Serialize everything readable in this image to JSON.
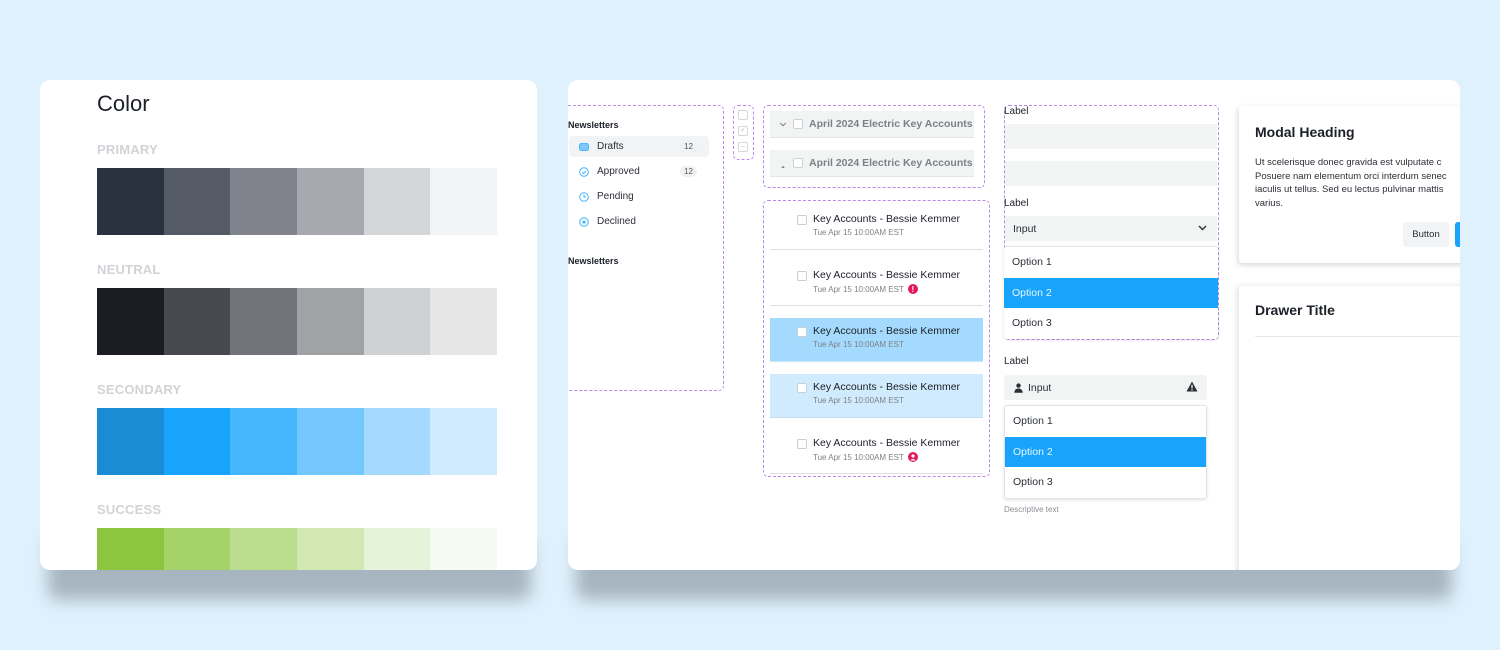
{
  "color_card": {
    "title": "Color",
    "palettes": [
      {
        "label": "PRIMARY",
        "swatches": [
          "#2a3240",
          "#545a66",
          "#80838b",
          "#a6a9b0",
          "#d4d6d9",
          "#f2f3f4"
        ]
      },
      {
        "label": "NEUTRAL",
        "swatches": [
          "#1a1d24",
          "#464950",
          "#727479",
          "#a1a2a6",
          "#d0d1d3",
          "#e6e6e6"
        ]
      },
      {
        "label": "SECONDARY",
        "swatches": [
          "#1a8cd6",
          "#18a4fb",
          "#46b6fc",
          "#73c7fd",
          "#a4dafd",
          "#d0ebfd"
        ]
      },
      {
        "label": "SUCCESS",
        "swatches": [
          "#8cc63f",
          "#a6d26a",
          "#bbdd8e",
          "#d2e8b3",
          "#e5f3d8",
          "#f6faf1"
        ]
      }
    ]
  },
  "nav": {
    "heading_1": "Newsletters",
    "heading_2": "Newsletters",
    "items": [
      {
        "label": "Drafts",
        "icon": "inbox-icon",
        "count": "12",
        "active": true
      },
      {
        "label": "Approved",
        "icon": "check-circle-icon",
        "count": "12",
        "active": false
      },
      {
        "label": "Pending",
        "icon": "clock-icon",
        "count": "",
        "active": false
      },
      {
        "label": "Declined",
        "icon": "x-circle-icon",
        "count": "",
        "active": false
      }
    ]
  },
  "checkbox_states": [
    "unchecked",
    "checked",
    "indeterminate"
  ],
  "accordion": {
    "rows": [
      {
        "label": "April 2024 Electric Key Accounts",
        "state": "collapsed",
        "chevron": "chevron-down-icon"
      },
      {
        "label": "April 2024 Electric Key Accounts",
        "state": "expanded",
        "chevron": "chevron-up-icon"
      }
    ]
  },
  "list": {
    "items": [
      {
        "title": "Key Accounts - Bessie Kemmer",
        "subtitle": "Tue Apr 15 10:00AM EST",
        "status": "",
        "state": "default"
      },
      {
        "title": "Key Accounts - Bessie Kemmer",
        "subtitle": "Tue Apr 15 10:00AM EST",
        "status": "alert",
        "state": "default"
      },
      {
        "title": "Key Accounts - Bessie Kemmer",
        "subtitle": "Tue Apr 15 10:00AM EST",
        "status": "",
        "state": "selected"
      },
      {
        "title": "Key Accounts - Bessie Kemmer",
        "subtitle": "Tue Apr 15 10:00AM EST",
        "status": "",
        "state": "hover"
      },
      {
        "title": "Key Accounts - Bessie Kemmer",
        "subtitle": "Tue Apr 15 10:00AM EST",
        "status": "user",
        "state": "default"
      }
    ]
  },
  "form": {
    "label_1": "Label",
    "input_1_value": "",
    "input_2_value": "",
    "label_2": "Label",
    "select_1_value": "Input",
    "select_1_options": [
      "Option 1",
      "Option 2",
      "Option 3"
    ],
    "select_1_selected": "Option 2",
    "label_3": "Label",
    "select_2_value": "Input",
    "select_2_options": [
      "Option 1",
      "Option 2",
      "Option 3"
    ],
    "select_2_selected": "Option 2",
    "help_text": "Descriptive text"
  },
  "modal": {
    "heading": "Modal Heading",
    "body": "Ut scelerisque donec gravida est vulputate c\nPosuere nam elementum orci interdum senec\niaculis ut tellus. Sed eu lectus pulvinar mattis\nvarius.",
    "secondary_button": "Button",
    "primary_button": ""
  },
  "drawer": {
    "title": "Drawer Title"
  },
  "colors": {
    "background": "#dff1fd",
    "accent": "#18a4fb",
    "dashed_outline": "#b889ec",
    "alert": "#e3195b"
  }
}
